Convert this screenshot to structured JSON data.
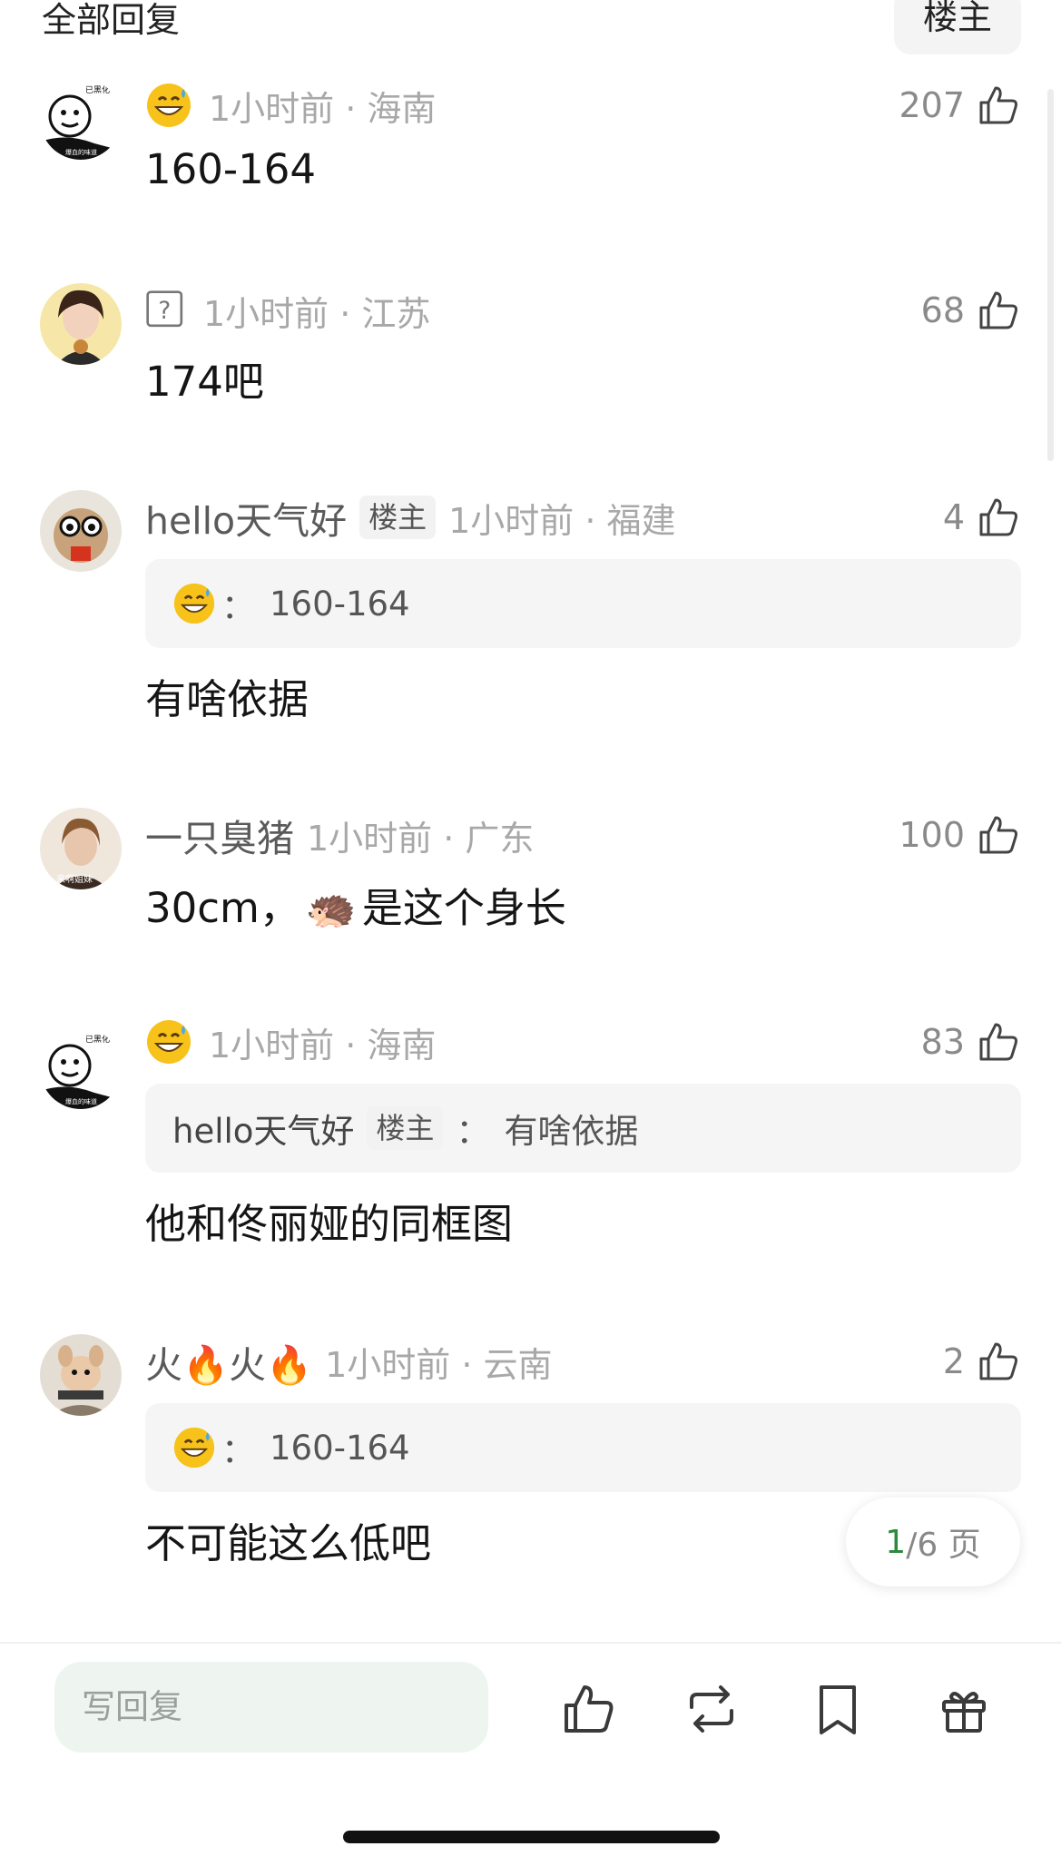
{
  "header": {
    "title": "全部回复",
    "filter_label": "楼主"
  },
  "comments": [
    {
      "meta_time": "1小时前 · 海南",
      "likes": "207",
      "text": "160-164"
    },
    {
      "meta_time": "1小时前 · 江苏",
      "likes": "68",
      "text": "174吧"
    },
    {
      "username": "hello天气好",
      "owner_tag": "楼主",
      "meta_time": "1小时前 · 福建",
      "likes": "4",
      "quote_text": "160-164",
      "quote_sep": "：",
      "text": "有啥依据"
    },
    {
      "username": "一只臭猪",
      "meta_time": "1小时前 · 广东",
      "likes": "100",
      "text_a": "30cm，",
      "text_emoji": "🦔",
      "text_b": "是这个身长"
    },
    {
      "meta_time": "1小时前 · 海南",
      "likes": "83",
      "quote_user": "hello天气好",
      "quote_tag": "楼主",
      "quote_sep": "：",
      "quote_text": "有啥依据",
      "text": "他和佟丽娅的同框图"
    },
    {
      "username": "火🔥火🔥",
      "meta_time": "1小时前 · 云南",
      "likes": "2",
      "quote_text": "160-164",
      "quote_sep": "：",
      "text": "不可能这么低吧"
    }
  ],
  "avatar_texts": {
    "a1_top": "已黑化",
    "a1_bottom": "爆血的味道",
    "a4": "来啊姐妹"
  },
  "pager": {
    "current": "1",
    "rest": "/6 页"
  },
  "bottom_bar": {
    "reply_placeholder": "写回复"
  },
  "icons": [
    "thumbs-up-icon",
    "repost-icon",
    "bookmark-icon",
    "gift-icon",
    "grin-sweat-emoji",
    "unknown-badge-icon"
  ],
  "colors": {
    "accent_green": "#2a8a3e",
    "meta_gray": "#a8a8a8",
    "input_bg": "#eef5f0"
  }
}
